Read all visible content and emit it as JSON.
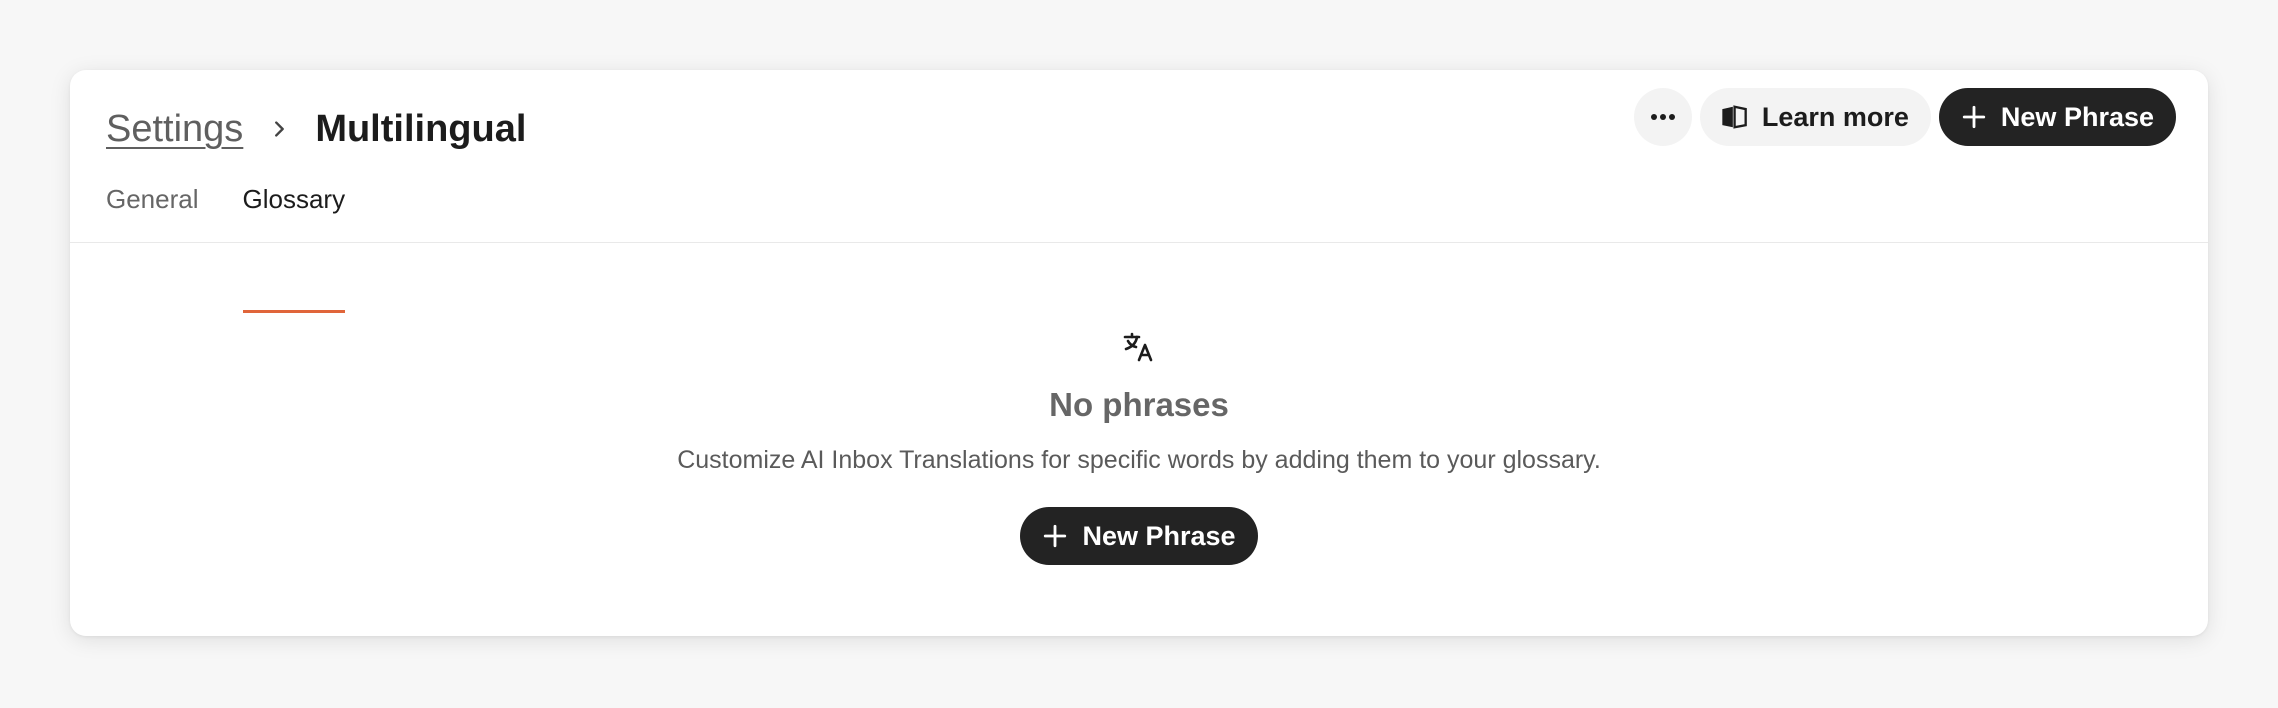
{
  "breadcrumb": {
    "parent": "Settings",
    "current": "Multilingual"
  },
  "actions": {
    "more_icon": "ellipsis-icon",
    "learn_more_label": "Learn more",
    "learn_more_icon": "book-open-icon",
    "new_phrase_label": "New Phrase",
    "new_phrase_icon": "plus-icon"
  },
  "tabs": [
    {
      "label": "General",
      "active": false
    },
    {
      "label": "Glossary",
      "active": true
    }
  ],
  "empty_state": {
    "icon": "translate-icon",
    "title": "No phrases",
    "description": "Customize AI Inbox Translations for specific words by adding them to your glossary.",
    "button_label": "New Phrase"
  },
  "colors": {
    "accent": "#e0653a",
    "primary_button": "#232323",
    "page_background": "#f7f7f7"
  }
}
